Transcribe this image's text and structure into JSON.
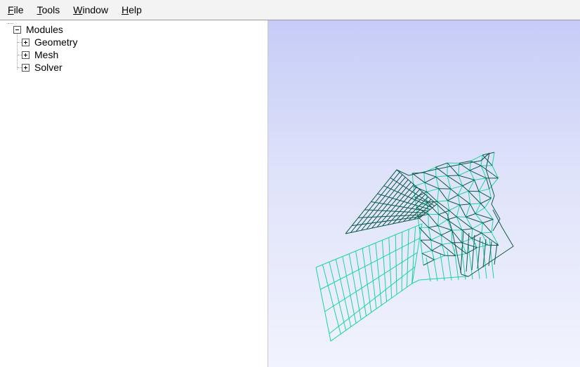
{
  "menubar": {
    "items": [
      {
        "mnemonic": "F",
        "rest": "ile"
      },
      {
        "mnemonic": "T",
        "rest": "ools"
      },
      {
        "mnemonic": "W",
        "rest": "indow"
      },
      {
        "mnemonic": "H",
        "rest": "elp"
      }
    ]
  },
  "tree": {
    "root": {
      "label": "Modules",
      "expanded": true
    },
    "children": [
      {
        "label": "Geometry",
        "expanded": false
      },
      {
        "label": "Mesh",
        "expanded": false
      },
      {
        "label": "Solver",
        "expanded": false
      }
    ]
  },
  "viewport": {
    "background_top": "#c6ccf7",
    "background_bottom": "#f1f3fd",
    "mesh_color_light": "#17d6a0",
    "mesh_color_dark": "#0b5a4a"
  }
}
